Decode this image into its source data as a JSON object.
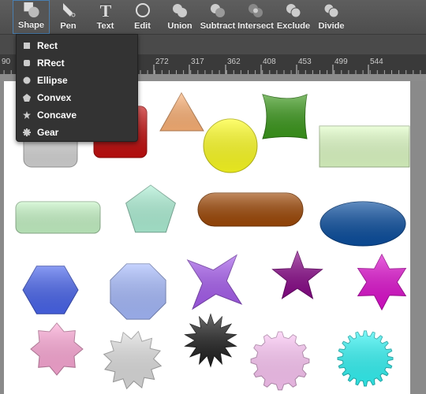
{
  "toolbar": {
    "tools": [
      {
        "label": "Shape",
        "icon": "shape-icon",
        "active": true
      },
      {
        "label": "Pen",
        "icon": "pen-icon"
      },
      {
        "label": "Text",
        "icon": "text-icon"
      },
      {
        "label": "Edit",
        "icon": "edit-icon"
      },
      {
        "label": "Union",
        "icon": "union-icon"
      },
      {
        "label": "Subtract",
        "icon": "subtract-icon"
      },
      {
        "label": "Intersect",
        "icon": "intersect-icon"
      },
      {
        "label": "Exclude",
        "icon": "exclude-icon"
      },
      {
        "label": "Divide",
        "icon": "divide-icon"
      }
    ]
  },
  "ruler": {
    "labels": [
      "90",
      "272",
      "317",
      "362",
      "408",
      "453",
      "499",
      "544"
    ]
  },
  "shape_menu": {
    "items": [
      {
        "label": "Rect",
        "icon": "rect-icon"
      },
      {
        "label": "RRect",
        "icon": "rrect-icon"
      },
      {
        "label": "Ellipse",
        "icon": "ellipse-icon"
      },
      {
        "label": "Convex",
        "icon": "pentagon-icon"
      },
      {
        "label": "Concave",
        "icon": "star-icon"
      },
      {
        "label": "Gear",
        "icon": "gear-icon"
      }
    ]
  },
  "shapes": [
    {
      "kind": "rrect",
      "fill": "#d8d8d8"
    },
    {
      "kind": "rrect",
      "fill": "#c40f0f"
    },
    {
      "kind": "triangle",
      "fill": "#ffb478"
    },
    {
      "kind": "ellipse",
      "fill": "#ffff22"
    },
    {
      "kind": "convex",
      "fill": "#3c9a1c"
    },
    {
      "kind": "rect",
      "fill": "#e2ffc8"
    },
    {
      "kind": "rrect",
      "fill": "#c8f7c8"
    },
    {
      "kind": "pentagon",
      "fill": "#b0f3d8"
    },
    {
      "kind": "pill",
      "fill": "#a04a08"
    },
    {
      "kind": "ellipse",
      "fill": "#0b4fa0"
    },
    {
      "kind": "hexagon",
      "fill": "#4a66ee"
    },
    {
      "kind": "octagon",
      "fill": "#a8bcff"
    },
    {
      "kind": "star4",
      "fill": "#a85ef0"
    },
    {
      "kind": "star5",
      "fill": "#8a0a8a"
    },
    {
      "kind": "star6",
      "fill": "#e010d0"
    },
    {
      "kind": "star8",
      "fill": "#ffaad8"
    },
    {
      "kind": "star12",
      "fill": "#e0e0e0"
    },
    {
      "kind": "star14",
      "fill": "#222222"
    },
    {
      "kind": "gear",
      "fill": "#ffc8f8"
    },
    {
      "kind": "gear",
      "fill": "#33f7f7"
    }
  ]
}
